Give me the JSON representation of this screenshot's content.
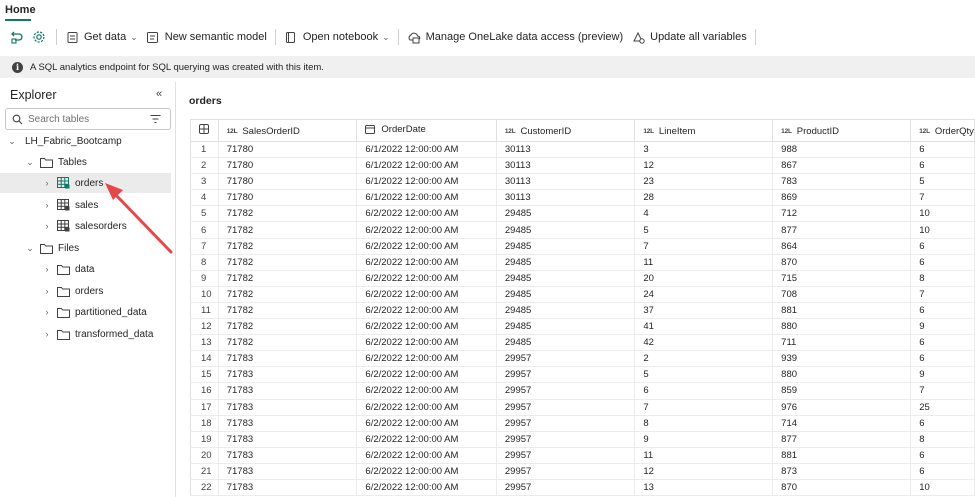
{
  "tabs": {
    "home": "Home"
  },
  "ribbon": {
    "get_data": "Get data",
    "new_semantic_model": "New semantic model",
    "open_notebook": "Open notebook",
    "manage_onelake": "Manage OneLake data access (preview)",
    "update_variables": "Update all variables"
  },
  "infobar": {
    "message": "A SQL analytics endpoint for SQL querying was created with this item."
  },
  "explorer": {
    "title": "Explorer",
    "search_placeholder": "Search tables",
    "lakehouse": "LH_Fabric_Bootcamp",
    "tables_folder": "Tables",
    "tables": [
      "orders",
      "sales",
      "salesorders"
    ],
    "files_folder": "Files",
    "files": [
      "data",
      "orders",
      "partitioned_data",
      "transformed_data"
    ]
  },
  "main": {
    "title": "orders",
    "type_badge": "12L",
    "columns": [
      "SalesOrderID",
      "OrderDate",
      "CustomerID",
      "LineItem",
      "ProductID",
      "OrderQty"
    ],
    "rows": [
      [
        "1",
        "71780",
        "6/1/2022 12:00:00 AM",
        "30113",
        "3",
        "988",
        "6"
      ],
      [
        "2",
        "71780",
        "6/1/2022 12:00:00 AM",
        "30113",
        "12",
        "867",
        "6"
      ],
      [
        "3",
        "71780",
        "6/1/2022 12:00:00 AM",
        "30113",
        "23",
        "783",
        "5"
      ],
      [
        "4",
        "71780",
        "6/1/2022 12:00:00 AM",
        "30113",
        "28",
        "869",
        "7"
      ],
      [
        "5",
        "71782",
        "6/2/2022 12:00:00 AM",
        "29485",
        "4",
        "712",
        "10"
      ],
      [
        "6",
        "71782",
        "6/2/2022 12:00:00 AM",
        "29485",
        "5",
        "877",
        "10"
      ],
      [
        "7",
        "71782",
        "6/2/2022 12:00:00 AM",
        "29485",
        "7",
        "864",
        "6"
      ],
      [
        "8",
        "71782",
        "6/2/2022 12:00:00 AM",
        "29485",
        "11",
        "870",
        "6"
      ],
      [
        "9",
        "71782",
        "6/2/2022 12:00:00 AM",
        "29485",
        "20",
        "715",
        "8"
      ],
      [
        "10",
        "71782",
        "6/2/2022 12:00:00 AM",
        "29485",
        "24",
        "708",
        "7"
      ],
      [
        "11",
        "71782",
        "6/2/2022 12:00:00 AM",
        "29485",
        "37",
        "881",
        "6"
      ],
      [
        "12",
        "71782",
        "6/2/2022 12:00:00 AM",
        "29485",
        "41",
        "880",
        "9"
      ],
      [
        "13",
        "71782",
        "6/2/2022 12:00:00 AM",
        "29485",
        "42",
        "711",
        "6"
      ],
      [
        "14",
        "71783",
        "6/2/2022 12:00:00 AM",
        "29957",
        "2",
        "939",
        "6"
      ],
      [
        "15",
        "71783",
        "6/2/2022 12:00:00 AM",
        "29957",
        "5",
        "880",
        "9"
      ],
      [
        "16",
        "71783",
        "6/2/2022 12:00:00 AM",
        "29957",
        "6",
        "859",
        "7"
      ],
      [
        "17",
        "71783",
        "6/2/2022 12:00:00 AM",
        "29957",
        "7",
        "976",
        "25"
      ],
      [
        "18",
        "71783",
        "6/2/2022 12:00:00 AM",
        "29957",
        "8",
        "714",
        "6"
      ],
      [
        "19",
        "71783",
        "6/2/2022 12:00:00 AM",
        "29957",
        "9",
        "877",
        "8"
      ],
      [
        "20",
        "71783",
        "6/2/2022 12:00:00 AM",
        "29957",
        "11",
        "881",
        "6"
      ],
      [
        "21",
        "71783",
        "6/2/2022 12:00:00 AM",
        "29957",
        "12",
        "873",
        "6"
      ],
      [
        "22",
        "71783",
        "6/2/2022 12:00:00 AM",
        "29957",
        "13",
        "870",
        "10"
      ]
    ]
  },
  "colors": {
    "accent": "#117865",
    "arrow": "#e8474a",
    "infobar_bg": "#f0f0f0",
    "selected_row": "#ebebeb"
  },
  "icons": {
    "refresh": "refresh-icon",
    "settings": "gear-icon",
    "get_data": "database-icon",
    "semantic_model": "semantic-model-icon",
    "notebook": "notebook-icon",
    "onelake": "onelake-icon",
    "variables": "variables-icon",
    "info": "info-icon",
    "search": "search-icon",
    "filter": "filter-icon",
    "collapse": "double-chevron-left-icon",
    "table": "table-icon",
    "folder": "folder-icon"
  }
}
